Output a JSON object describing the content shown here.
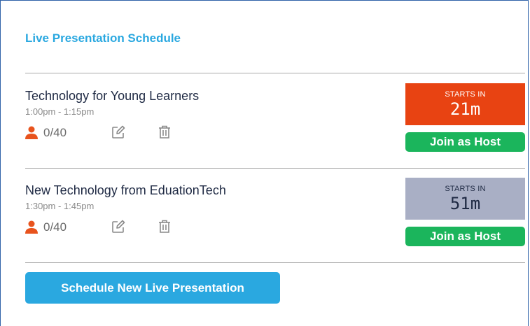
{
  "schedule": {
    "title": "Live Presentation Schedule",
    "sessions": [
      {
        "title": "Technology for Young Learners",
        "time": "1:00pm - 1:15pm",
        "attendees": "0/40",
        "starts_label": "STARTS IN",
        "starts_value": "21m",
        "starts_color": "#e84312",
        "starts_text_color": "#ffffff",
        "join_label": "Join as Host"
      },
      {
        "title": "New Technology from EduationTech",
        "time": "1:30pm - 1:45pm",
        "attendees": "0/40",
        "starts_label": "STARTS IN",
        "starts_value": "51m",
        "starts_color": "#a9afc5",
        "starts_text_color": "#1f2a44",
        "join_label": "Join as Host"
      }
    ],
    "new_button_label": "Schedule New Live Presentation"
  },
  "colors": {
    "accent": "#2aa8e0",
    "host_button": "#1bb55c",
    "person_icon": "#e8531d"
  },
  "icons": {
    "attendees": "person-icon",
    "edit": "edit-icon",
    "delete": "trash-icon"
  }
}
